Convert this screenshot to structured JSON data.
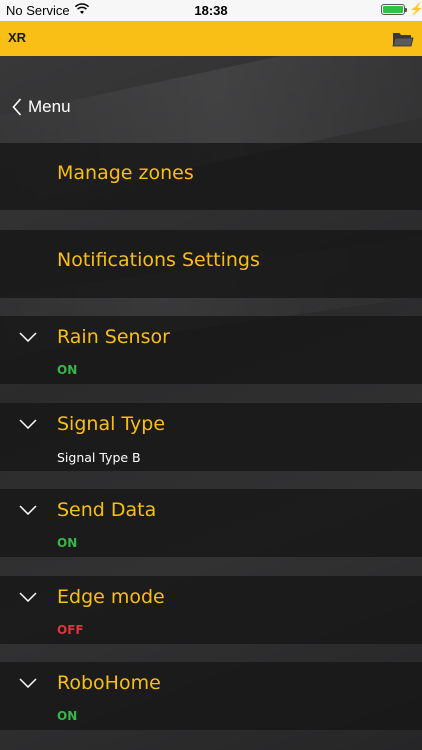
{
  "status_bar": {
    "carrier": "No Service",
    "time": "18:38",
    "battery_fill": 1.0,
    "battery_color": "#2fc24a"
  },
  "app_bar": {
    "title": "XR",
    "icon": "folder-icon",
    "color": "#f9bf17"
  },
  "nav": {
    "back_label": "Menu",
    "icon": "chevron-left-icon"
  },
  "menu_items": [
    {
      "label": "Manage zones"
    },
    {
      "label": "Notifications Settings"
    }
  ],
  "settings": [
    {
      "label": "Rain Sensor",
      "value": "ON",
      "state": "on"
    },
    {
      "label": "Signal Type",
      "value": "Signal Type B",
      "state": "plain"
    },
    {
      "label": "Send Data",
      "value": "ON",
      "state": "on"
    },
    {
      "label": "Edge mode",
      "value": "OFF",
      "state": "off"
    },
    {
      "label": "RoboHome",
      "value": "ON",
      "state": "on"
    }
  ],
  "colors": {
    "accent": "#f9bf17",
    "on": "#39b54a",
    "off": "#e0353b"
  }
}
